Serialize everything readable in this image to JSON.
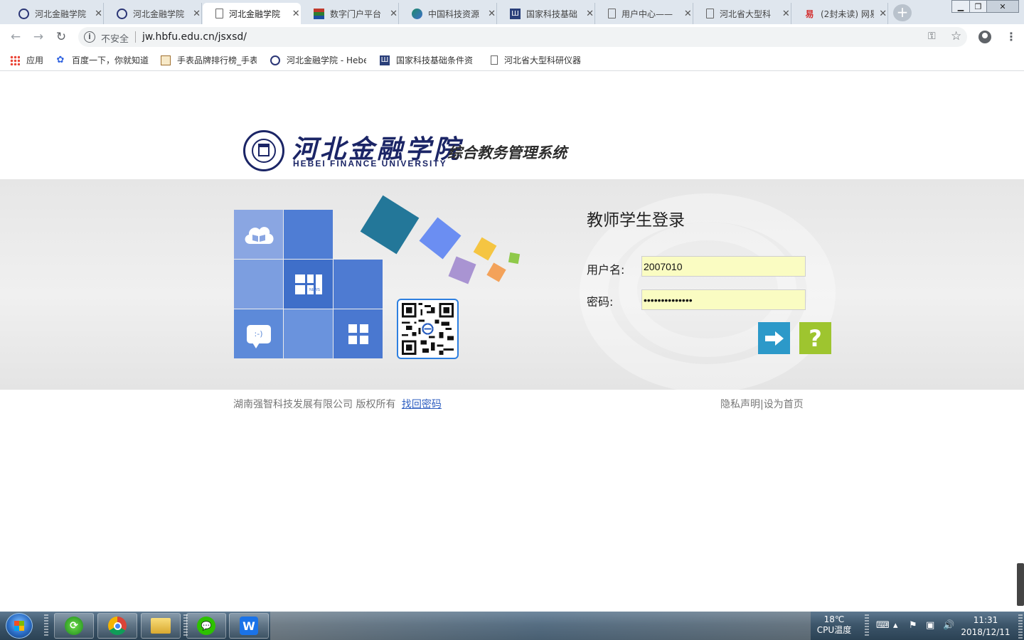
{
  "browser": {
    "tabs": [
      {
        "label": "河北金融学院",
        "active": false
      },
      {
        "label": "河北金融学院",
        "active": false
      },
      {
        "label": "河北金融学院",
        "active": true
      },
      {
        "label": "数字门户平台",
        "active": false
      },
      {
        "label": "中国科技资源",
        "active": false
      },
      {
        "label": "国家科技基础",
        "active": false
      },
      {
        "label": "用户中心——",
        "active": false
      },
      {
        "label": "河北省大型科",
        "active": false
      },
      {
        "label": "(2封未读) 网易",
        "active": false
      }
    ],
    "new_tab": "+",
    "address": {
      "security_label": "不安全",
      "url": "jw.hbfu.edu.cn/jsxsd/"
    },
    "bookmarks": [
      {
        "label": "应用"
      },
      {
        "label": "百度一下，你就知道"
      },
      {
        "label": "手表品牌排行榜_手表"
      },
      {
        "label": "河北金融学院 - Hebe"
      },
      {
        "label": "国家科技基础条件资"
      },
      {
        "label": "河北省大型科研仪器"
      }
    ]
  },
  "page": {
    "school_name_cn": "河北金融学院",
    "school_name_en": "HEBEI FINANCE UNIVERSITY",
    "system_name": "综合教务管理系统",
    "login": {
      "title": "教师学生登录",
      "username_label": "用户名:",
      "username_value": "2007010",
      "password_label": "密码:",
      "password_value": "••••••••••••••",
      "help_label": "?"
    },
    "tiles": {
      "chat_text": ":-)",
      "news_text": "NEWS"
    },
    "footer": {
      "copyright": "湖南强智科技发展有限公司 版权所有",
      "recover_link": "找回密码",
      "privacy": "隐私声明",
      "divider": "|",
      "set_home": "设为首页"
    }
  },
  "taskbar": {
    "temperature": "18℃",
    "cpu_label": "CPU温度",
    "time": "11:31",
    "date": "2018/12/11"
  }
}
